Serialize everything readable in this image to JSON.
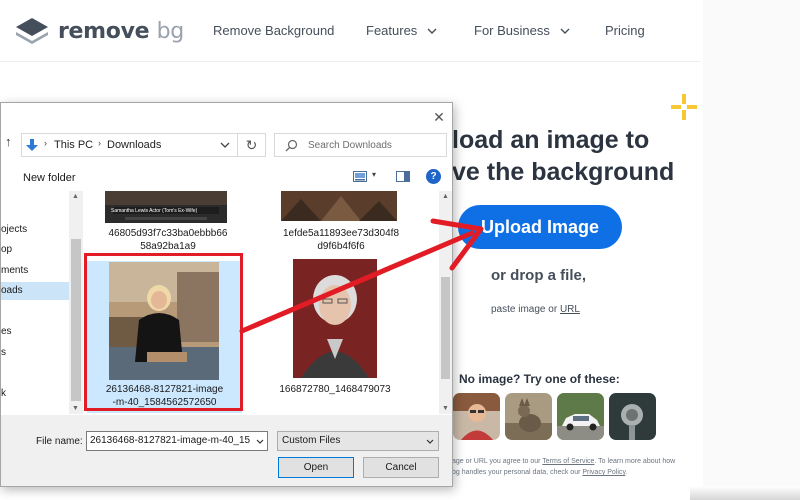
{
  "site": {
    "logo": {
      "word1": "remove",
      "word2": "bg"
    },
    "nav": {
      "remove_background": "Remove Background",
      "features": "Features",
      "for_business": "For Business",
      "pricing": "Pricing"
    },
    "hero_line1": "load an image to",
    "hero_line2": "ve the background",
    "upload_button": "Upload Image",
    "drop_text": "or drop a file,",
    "paste_prefix": "paste image or",
    "paste_url": "URL",
    "try_text": "No image? Try one of these:",
    "legal": {
      "line1_prefix": "age or URL you agree to our",
      "terms": "Terms of Service",
      "line1_suffix": ". To learn more about how",
      "line2_prefix": "bg handles your personal data, check our",
      "privacy": "Privacy Policy",
      "line2_suffix": "."
    },
    "colors": {
      "accent": "#0f70e6",
      "sparkle": "#f7c831",
      "text": "#454f5b"
    }
  },
  "dialog": {
    "breadcrumb": [
      "This PC",
      "Downloads"
    ],
    "search_placeholder": "Search Downloads",
    "new_folder": "New folder",
    "help": "?",
    "nav_items": [
      "ojects",
      "op",
      "ments",
      "oads",
      "",
      "es",
      "s",
      "",
      "k"
    ],
    "files": [
      {
        "caption_lines": [
          "46805d93f7c33ba0ebbb66",
          "58a92ba1a9"
        ],
        "thumb_text": "Samantha Lewis Actor (Tom's Ex-Wife)"
      },
      {
        "caption_lines": [
          "1efde5a11893ee73d304f8",
          "d9f6b4f6f6"
        ]
      },
      {
        "caption_lines": [
          "26136468-8127821-image",
          "-m-40_1584562572650"
        ],
        "selected": true
      },
      {
        "caption_lines": [
          "166872780_1468479073"
        ]
      }
    ],
    "file_name_label": "File name:",
    "file_name_value": "26136468-8127821-image-m-40_15",
    "filter_value": "Custom Files",
    "open_button": "Open",
    "cancel_button": "Cancel",
    "colors": {
      "highlight": "#e11c24",
      "selection": "#cce8ff"
    }
  }
}
